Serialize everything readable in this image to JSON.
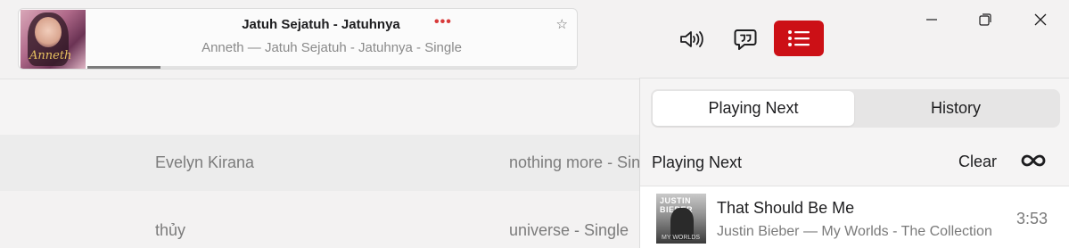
{
  "now_playing": {
    "title": "Jatuh Sejatuh - Jatuhnya",
    "more_label": "•••",
    "subtitle": "Anneth — Jatuh Sejatuh - Jatuhnya - Single",
    "favorite_icon": "star-icon",
    "progress": 0.15
  },
  "toolbar": {
    "volume_icon": "speaker-volume-icon",
    "lyrics_icon": "lyrics-bubble-icon",
    "queue_icon": "queue-list-icon",
    "queue_active_color": "#cc1016"
  },
  "window_controls": {
    "minimize_icon": "minimize-icon",
    "maximize_icon": "restore-icon",
    "close_icon": "close-icon"
  },
  "song_list": {
    "rows": [
      {
        "artist": "Evelyn Kirana",
        "album": "nothing more - Sin"
      },
      {
        "artist": "thủy",
        "album": "universe - Single"
      }
    ]
  },
  "queue_panel": {
    "tabs": [
      {
        "label": "Playing Next",
        "active": true
      },
      {
        "label": "History",
        "active": false
      }
    ],
    "section_label": "Playing Next",
    "clear_label": "Clear",
    "autoplay_icon": "infinity-icon",
    "items": [
      {
        "title": "That Should Be Me",
        "subtitle": "Justin Bieber — My Worlds - The Collection",
        "duration": "3:53",
        "art_header": "JUSTIN BIEBER",
        "art_footer": "MY WORLDS"
      }
    ]
  }
}
